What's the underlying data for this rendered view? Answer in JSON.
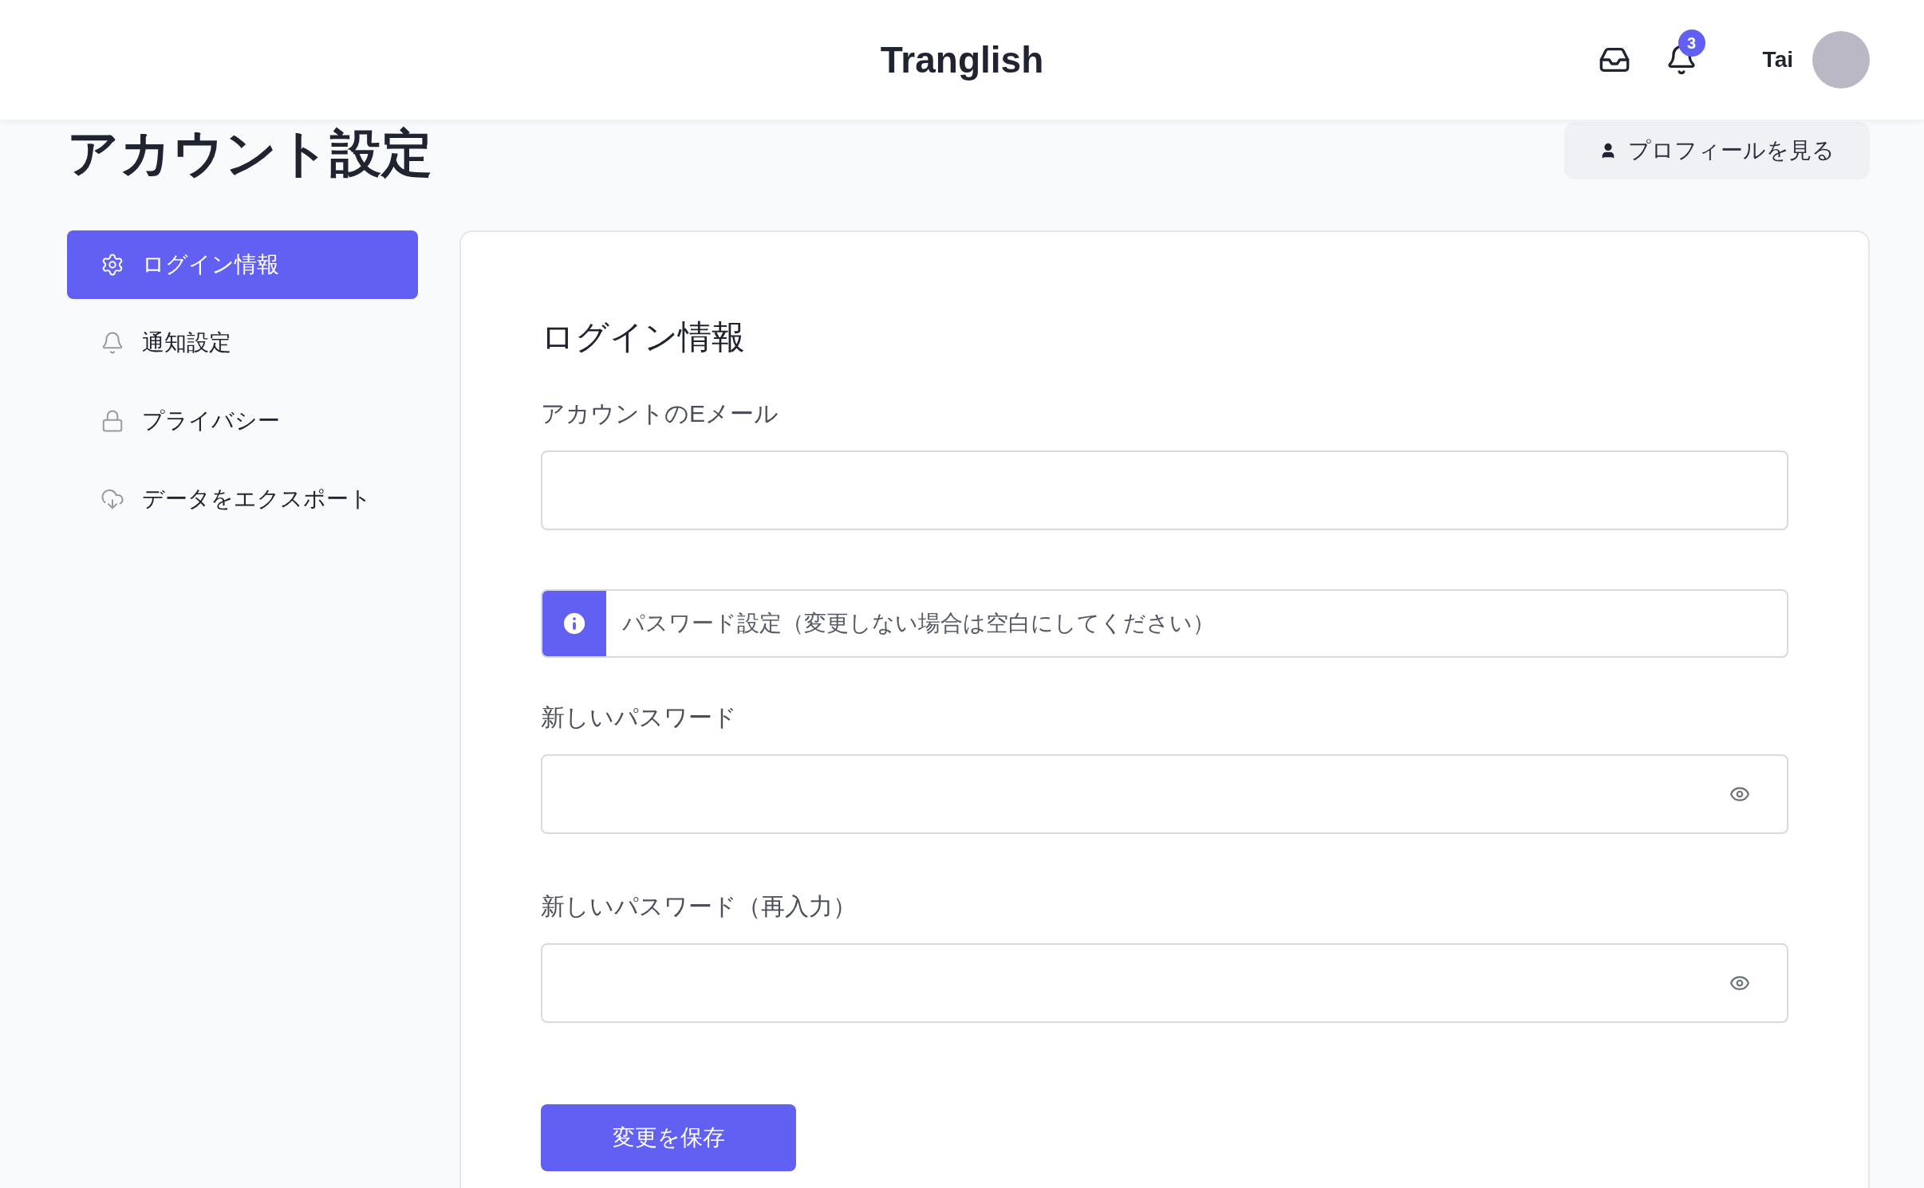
{
  "header": {
    "brand": "Tranglish",
    "notification_count": "3",
    "user_name": "Tai"
  },
  "page": {
    "title": "アカウント設定",
    "profile_button": "プロフィールを見る"
  },
  "sidebar": {
    "items": [
      {
        "label": "ログイン情報",
        "selected": true
      },
      {
        "label": "通知設定",
        "selected": false
      },
      {
        "label": "プライバシー",
        "selected": false
      },
      {
        "label": "データをエクスポート",
        "selected": false
      }
    ]
  },
  "form": {
    "heading": "ログイン情報",
    "fields": [
      {
        "kind": "input",
        "label": "アカウントのEメール",
        "password": false
      },
      {
        "kind": "notice",
        "text": "パスワード設定（変更しない場合は空白にしてください）"
      },
      {
        "kind": "input",
        "label": "新しいパスワード",
        "password": true
      },
      {
        "kind": "input",
        "label": "新しいパスワード（再入力）",
        "password": true
      }
    ],
    "save_button": "変更を保存"
  }
}
